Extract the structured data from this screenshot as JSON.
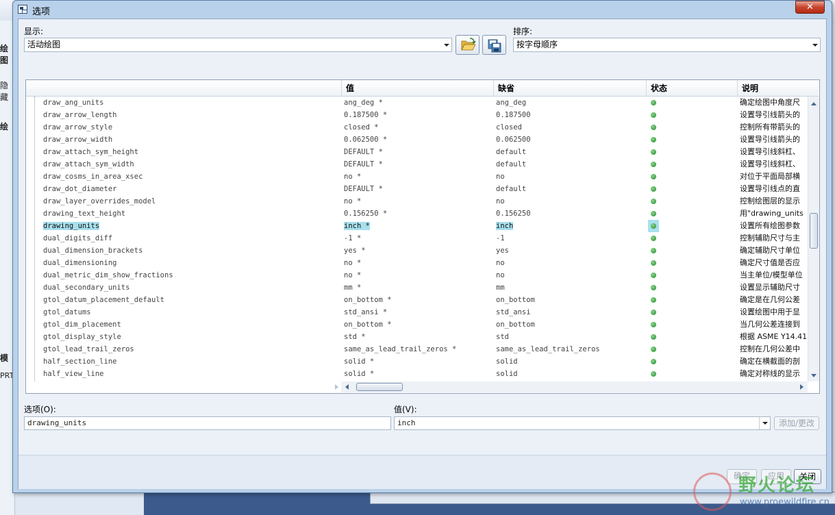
{
  "dialog": {
    "title": "选项",
    "close_symbol": "✕"
  },
  "background": {
    "left_labels": [
      "绘图",
      "隐藏",
      "绘",
      "模",
      "PRT"
    ]
  },
  "display": {
    "label": "显示:",
    "value": "活动绘图"
  },
  "sort": {
    "label": "排序:",
    "value": "按字母顺序"
  },
  "table": {
    "headers": {
      "name": "",
      "value": "值",
      "default": "缺省",
      "status": "状态",
      "desc": "说明"
    },
    "rows": [
      {
        "name": "draw_ang_units",
        "value": "ang_deg *",
        "default": "ang_deg",
        "desc": "确定绘图中角度尺"
      },
      {
        "name": "draw_arrow_length",
        "value": "0.187500 *",
        "default": "0.187500",
        "desc": "设置导引线箭头的"
      },
      {
        "name": "draw_arrow_style",
        "value": "closed *",
        "default": "closed",
        "desc": "控制所有带箭头的"
      },
      {
        "name": "draw_arrow_width",
        "value": "0.062500 *",
        "default": "0.062500",
        "desc": "设置导引线箭头的"
      },
      {
        "name": "draw_attach_sym_height",
        "value": "DEFAULT *",
        "default": "default",
        "desc": "设置导引线斜杠、"
      },
      {
        "name": "draw_attach_sym_width",
        "value": "DEFAULT *",
        "default": "default",
        "desc": "设置导引线斜杠、"
      },
      {
        "name": "draw_cosms_in_area_xsec",
        "value": "no *",
        "default": "no",
        "desc": "对位于平面局部横"
      },
      {
        "name": "draw_dot_diameter",
        "value": "DEFAULT *",
        "default": "default",
        "desc": "设置导引线点的直"
      },
      {
        "name": "draw_layer_overrides_model",
        "value": "no *",
        "default": "no",
        "desc": "控制绘图层的显示"
      },
      {
        "name": "drawing_text_height",
        "value": "0.156250 *",
        "default": "0.156250",
        "desc": "用\"drawing_units"
      },
      {
        "name": "drawing_units",
        "value": "inch *",
        "default": "inch",
        "desc": "设置所有绘图参数",
        "selected": true
      },
      {
        "name": "dual_digits_diff",
        "value": "-1 *",
        "default": "-1",
        "desc": "控制辅助尺寸与主"
      },
      {
        "name": "dual_dimension_brackets",
        "value": "yes *",
        "default": "yes",
        "desc": "确定辅助尺寸单位"
      },
      {
        "name": "dual_dimensioning",
        "value": "no *",
        "default": "no",
        "desc": "确定尺寸值是否应"
      },
      {
        "name": "dual_metric_dim_show_fractions",
        "value": "no *",
        "default": "no",
        "desc": "当主单位/模型单位"
      },
      {
        "name": "dual_secondary_units",
        "value": "mm *",
        "default": "mm",
        "desc": "设置显示辅助尺寸"
      },
      {
        "name": "gtol_datum_placement_default",
        "value": "on_bottom *",
        "default": "on_bottom",
        "desc": "确定是在几何公差"
      },
      {
        "name": "gtol_datums",
        "value": "std_ansi *",
        "default": "std_ansi",
        "desc": "设置绘图中用于显"
      },
      {
        "name": "gtol_dim_placement",
        "value": "on_bottom *",
        "default": "on_bottom",
        "desc": "当几何公差连接到"
      },
      {
        "name": "gtol_display_style",
        "value": "std *",
        "default": "std",
        "desc": "根据 ASME Y14.41"
      },
      {
        "name": "gtol_lead_trail_zeros",
        "value": "same_as_lead_trail_zeros *",
        "default": "same_as_lead_trail_zeros",
        "desc": "控制在几何公差中"
      },
      {
        "name": "half_section_line",
        "value": "solid *",
        "default": "solid",
        "desc": "确定在横截面的剖"
      },
      {
        "name": "half_view_line",
        "value": "solid *",
        "default": "solid",
        "desc": "确定对称线的显示"
      }
    ]
  },
  "option_field": {
    "label": "选项(O):",
    "value": "drawing_units"
  },
  "value_field": {
    "label": "值(V):",
    "value": "inch"
  },
  "buttons": {
    "add_change": "添加/更改",
    "ok": "确定",
    "apply": "应用",
    "close": "关闭"
  },
  "watermark": {
    "text": "野火论坛",
    "url": "www.proewildfire.cn"
  },
  "colors": {
    "status_dot": "#1f8f2a",
    "selection": "#a8e0ee",
    "dialog_frame": "#b9d1ea"
  }
}
